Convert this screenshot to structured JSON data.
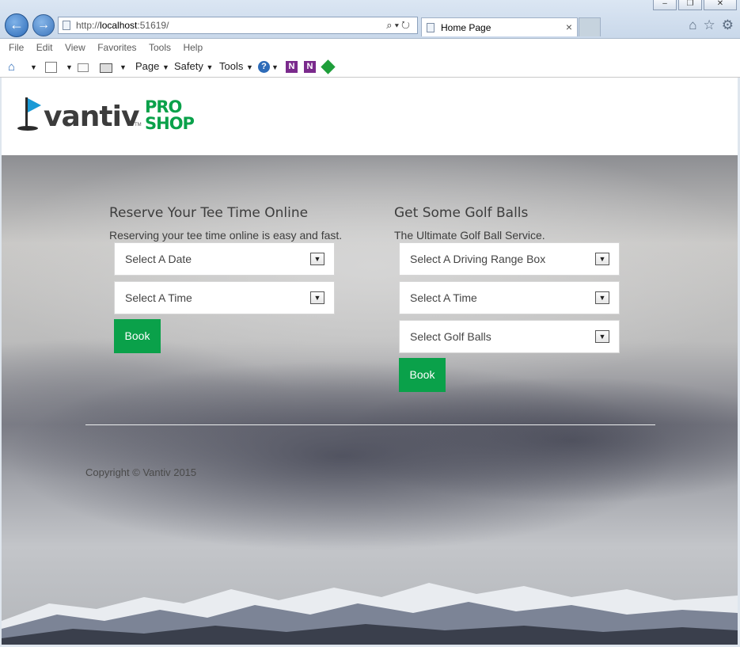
{
  "browser": {
    "address_url_prefix": "http://",
    "address_url_host": "localhost",
    "address_url_rest": ":51619/",
    "tab_title": "Home Page",
    "tab_close": "×",
    "menu": [
      "File",
      "Edit",
      "View",
      "Favorites",
      "Tools",
      "Help"
    ],
    "command_bar": {
      "page": "Page",
      "safety": "Safety",
      "tools": "Tools"
    }
  },
  "site": {
    "brand": "vantiv",
    "brand_tm": "TM",
    "brand_pro": "PRO",
    "brand_shop": "SHOP",
    "accent_color": "#0aa14a",
    "flag_color": "#1a9ad6"
  },
  "tee_time": {
    "heading": "Reserve Your Tee Time Online",
    "subtext": "Reserving your tee time online is easy and fast.",
    "date_select": "Select A Date",
    "time_select": "Select A Time",
    "book_label": "Book"
  },
  "golf_balls": {
    "heading": "Get Some Golf Balls",
    "subtext": "The Ultimate Golf Ball Service.",
    "range_box_select": "Select A Driving Range Box",
    "time_select": "Select A Time",
    "balls_select": "Select Golf Balls",
    "book_label": "Book"
  },
  "footer": {
    "copyright": "Copyright © Vantiv 2015"
  }
}
